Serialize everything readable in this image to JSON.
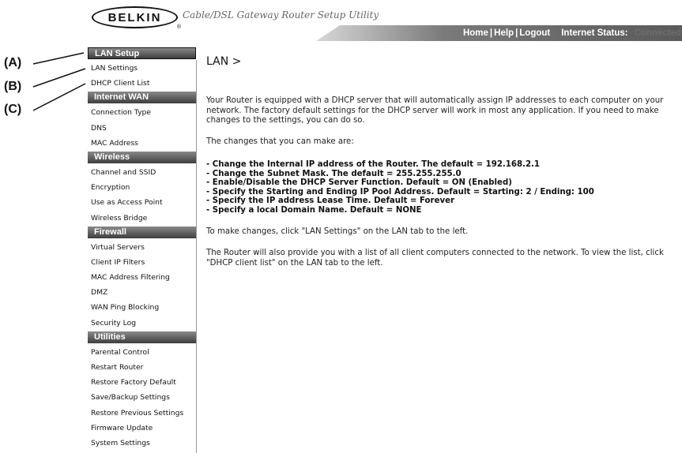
{
  "header": {
    "logo": "BELKIN",
    "logo_mark": "®",
    "app_title": "Cable/DSL Gateway Router Setup Utility",
    "links": [
      "Home",
      "Help",
      "Logout"
    ],
    "separator": "|",
    "internet_status_label": "Internet Status:",
    "internet_status_value": "Connected"
  },
  "callouts": [
    "(A)",
    "(B)",
    "(C)"
  ],
  "sidebar": {
    "sections": [
      {
        "title": "LAN Setup",
        "items": [
          "LAN Settings",
          "DHCP Client List"
        ]
      },
      {
        "title": "Internet WAN",
        "items": [
          "Connection Type",
          "DNS",
          "MAC Address"
        ]
      },
      {
        "title": "Wireless",
        "items": [
          "Channel and SSID",
          "Encryption",
          "Use as Access Point",
          "Wireless Bridge"
        ]
      },
      {
        "title": "Firewall",
        "items": [
          "Virtual Servers",
          "Client IP Filters",
          "MAC Address Filtering",
          "DMZ",
          "WAN Ping Blocking",
          "Security Log"
        ]
      },
      {
        "title": "Utilities",
        "items": [
          "Parental Control",
          "Restart Router",
          "Restore Factory Default",
          "Save/Backup Settings",
          "Restore Previous Settings",
          "Firmware Update",
          "System Settings"
        ]
      }
    ]
  },
  "main": {
    "title": "LAN >",
    "intro": "Your Router is equipped with a DHCP server that will automatically assign IP addresses to each computer on your network. The factory default settings for the DHCP server will work in most any application. If you need to make changes to the settings, you can do so.",
    "changes_intro": "The changes that you can make are:",
    "changes": [
      "- Change the Internal IP address of the Router. The default = 192.168.2.1",
      "- Change the Subnet Mask. The default = 255.255.255.0",
      "- Enable/Disable the DHCP Server Function. Default = ON (Enabled)",
      "- Specify the Starting and Ending IP Pool Address. Default = Starting: 2 / Ending: 100",
      "- Specify the IP address Lease Time. Default = Forever",
      "- Specify a local Domain Name. Default = NONE"
    ],
    "changes_note": "To make changes, click \"LAN Settings\" on the LAN tab to the left.",
    "dhcp_note": "The Router will also provide you with a list of all client computers connected to the network. To view the list, click \"DHCP client list\" on the LAN tab to the left."
  }
}
